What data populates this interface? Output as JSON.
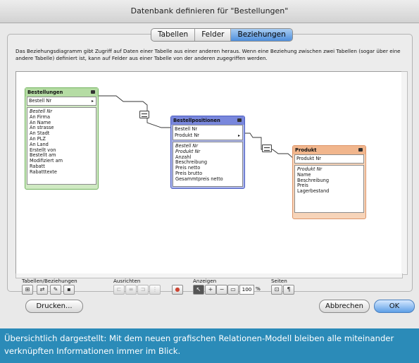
{
  "window": {
    "title": "Datenbank definieren für \"Bestellungen\""
  },
  "tabs": [
    {
      "label": "Tabellen",
      "active": false
    },
    {
      "label": "Felder",
      "active": false
    },
    {
      "label": "Beziehungen",
      "active": true
    }
  ],
  "description": "Das Beziehungsdiagramm gibt Zugriff auf Daten einer Tabelle aus einer anderen heraus. Wenn eine Beziehung zwischen zwei Tabellen (sogar über eine andere Tabelle) definiert ist, kann auf Felder aus einer Tabelle von der anderen zugegriffen werden.",
  "occurrences": {
    "bestellungen": {
      "title": "Bestellungen",
      "color": "#cfe9c2",
      "key_fields": [
        "Bestell Nr"
      ],
      "fields": [
        "Bestell Nr",
        "An Firma",
        "An Name",
        "An strasse",
        "An Stadt",
        "An PLZ",
        "An Land",
        "Erstellt von",
        "Bestellt am",
        "Modifiziert am",
        "Rabatt",
        "Rabatttexte"
      ]
    },
    "bestellpositionen": {
      "title": "Bestellpositionen",
      "color": "#aab4ea",
      "key_fields": [
        "Bestell Nr",
        "Produkt Nr"
      ],
      "fields": [
        "Bestell Nr",
        "Produkt Nr",
        "Anzahl",
        "Beschreibung",
        "Preis netto",
        "Preis brutto",
        "Gesammtpreis netto"
      ]
    },
    "produkt": {
      "title": "Produkt",
      "color": "#f7d4b9",
      "key_fields": [
        "Produkt Nr"
      ],
      "fields": [
        "Produkt Nr",
        "Name",
        "Beschreibung",
        "Preis",
        "Lagerbestand"
      ]
    }
  },
  "toolbar": {
    "groups": [
      "Tabellen/Beziehungen",
      "Ausrichten",
      "Anzeigen",
      "Seiten"
    ],
    "zoom": "100",
    "zoom_unit": "%"
  },
  "buttons": {
    "print": "Drucken...",
    "cancel": "Abbrechen",
    "ok": "OK"
  },
  "caption": "Übersichtlich dargestellt: Mit dem neuen grafischen Relationen-Modell bleiben alle miteinander verknüpften Informationen immer im Blick."
}
